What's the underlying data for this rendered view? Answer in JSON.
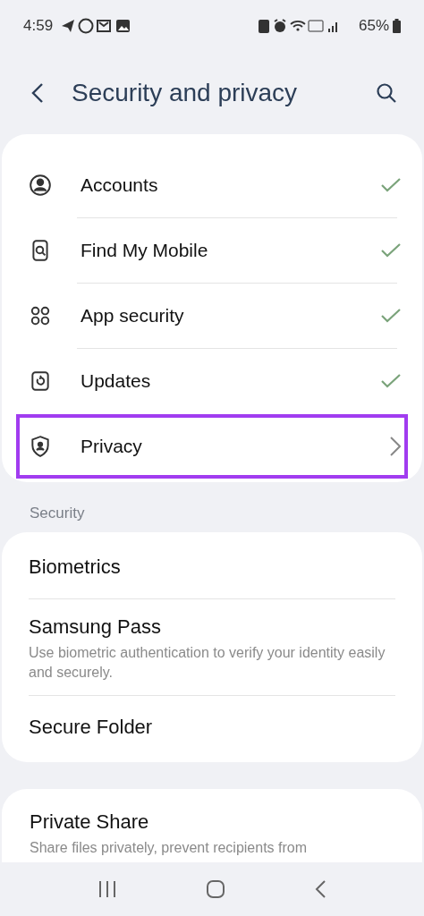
{
  "status_bar": {
    "time": "4:59",
    "battery": "65%"
  },
  "header": {
    "title": "Security and privacy"
  },
  "top_card": {
    "items": [
      {
        "label": "Accounts",
        "kind": "check",
        "highlighted": false
      },
      {
        "label": "Find My Mobile",
        "kind": "check",
        "highlighted": false
      },
      {
        "label": "App security",
        "kind": "check",
        "highlighted": false
      },
      {
        "label": "Updates",
        "kind": "check",
        "highlighted": false
      },
      {
        "label": "Privacy",
        "kind": "chevron",
        "highlighted": true
      }
    ]
  },
  "security_section": {
    "title": "Security",
    "items": [
      {
        "title": "Biometrics"
      },
      {
        "title": "Samsung Pass",
        "description": "Use biometric authentication to verify your identity easily and securely."
      },
      {
        "title": "Secure Folder"
      }
    ]
  },
  "other_card": {
    "items": [
      {
        "title": "Private Share",
        "description": "Share files privately, prevent recipients from"
      }
    ]
  }
}
